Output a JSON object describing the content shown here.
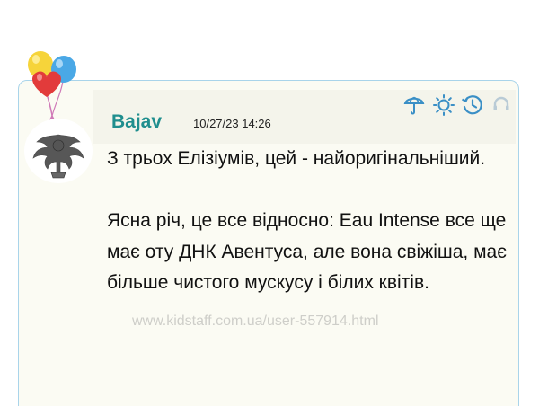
{
  "comment": {
    "author": "Bajav",
    "timestamp": "10/27/23 14:26",
    "paragraphs": [
      "З трьох Елізіумів, цей - найоригінальніший.",
      "Ясна річ, це все відносно: Eau Intense все ще має оту ДНК Авентуса, але вона свіжіша, має більше чистого мускусу і білих квітів."
    ]
  },
  "watermark": "www.kidstaff.com.ua/user-557914.html",
  "actions": [
    {
      "icon": "umbrella-icon"
    },
    {
      "icon": "sun-icon"
    },
    {
      "icon": "history-icon"
    },
    {
      "icon": "headset-icon"
    }
  ],
  "colors": {
    "username": "#1f8e8e",
    "card_border": "#a9d4ea",
    "card_background": "#fbfbf3",
    "icon_blue": "#3a8fc6",
    "balloon_yellow": "#f6d43a",
    "balloon_blue": "#4aa8e6",
    "balloon_red": "#e23b3b"
  }
}
